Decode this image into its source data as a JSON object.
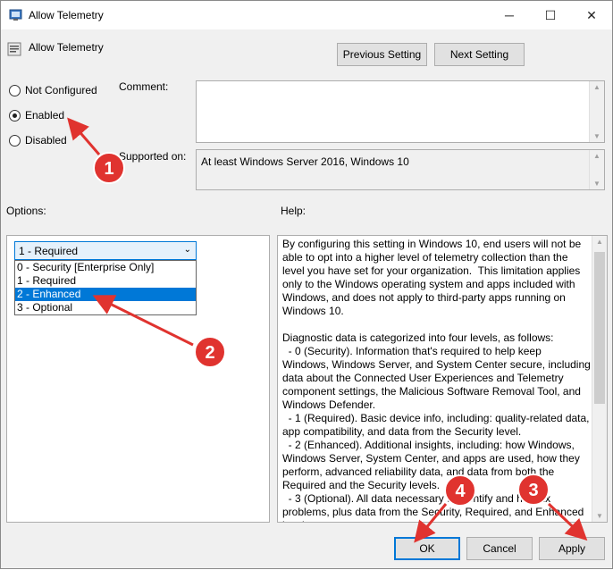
{
  "window": {
    "title": "Allow Telemetry",
    "minimize": "─",
    "maximize": "☐",
    "close": "✕"
  },
  "setting": {
    "name": "Allow Telemetry"
  },
  "nav": {
    "previous": "Previous Setting",
    "next": "Next Setting"
  },
  "state": {
    "not_configured": "Not Configured",
    "enabled": "Enabled",
    "disabled": "Disabled",
    "selected": "Enabled"
  },
  "labels": {
    "comment": "Comment:",
    "supported_on": "Supported on:",
    "options": "Options:",
    "help": "Help:"
  },
  "supported_on_value": "At least Windows Server 2016, Windows 10",
  "options": {
    "dropdown_value": "1 - Required",
    "items": [
      "0 - Security [Enterprise Only]",
      "1 - Required",
      "2 - Enhanced",
      "3 - Optional"
    ],
    "highlighted": "2 - Enhanced"
  },
  "help_text": "By configuring this setting in Windows 10, end users will not be able to opt into a higher level of telemetry collection than the level you have set for your organization.  This limitation applies only to the Windows operating system and apps included with Windows, and does not apply to third-party apps running on Windows 10.\n\nDiagnostic data is categorized into four levels, as follows:\n  - 0 (Security). Information that's required to help keep Windows, Windows Server, and System Center secure, including data about the Connected User Experiences and Telemetry component settings, the Malicious Software Removal Tool, and Windows Defender.\n  - 1 (Required). Basic device info, including: quality-related data, app compatibility, and data from the Security level.\n  - 2 (Enhanced). Additional insights, including: how Windows, Windows Server, System Center, and apps are used, how they perform, advanced reliability data, and data from both the Required and the Security levels.\n  - 3 (Optional). All data necessary to identify and help fix problems, plus data from the Security, Required, and Enhanced levels.",
  "buttons": {
    "ok": "OK",
    "cancel": "Cancel",
    "apply": "Apply"
  },
  "annotations": {
    "badge_1": "1",
    "badge_2": "2",
    "badge_3": "3",
    "badge_4": "4"
  },
  "colors": {
    "accent": "#0078d7",
    "annotation": "#e0332f"
  }
}
